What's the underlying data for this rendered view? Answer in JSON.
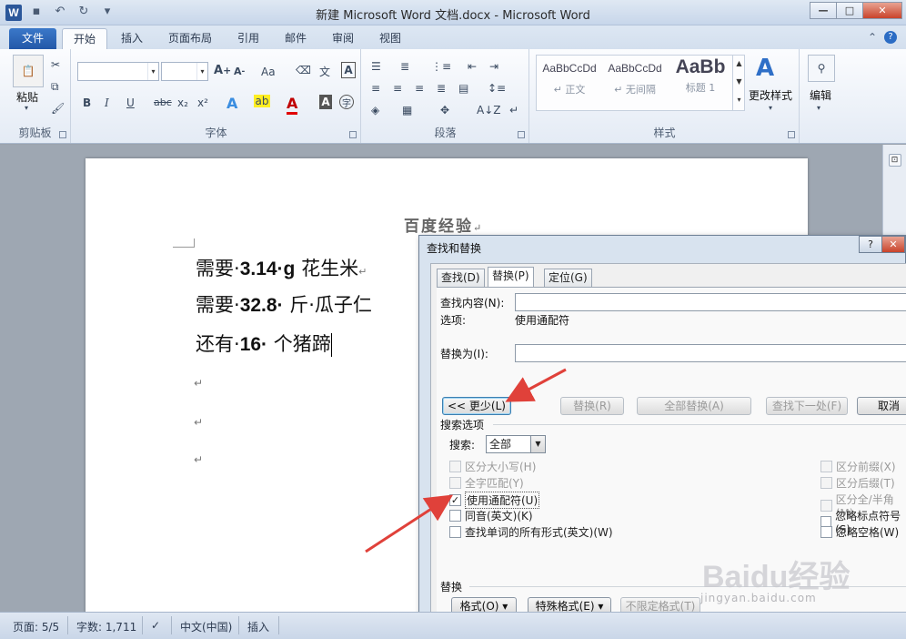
{
  "window": {
    "title": "新建 Microsoft Word 文档.docx - Microsoft Word"
  },
  "tabs": [
    "文件",
    "开始",
    "插入",
    "页面布局",
    "引用",
    "邮件",
    "审阅",
    "视图"
  ],
  "ribbon": {
    "clipboard": {
      "paste_label": "粘贴",
      "group_label": "剪贴板"
    },
    "font": {
      "group_label": "字体",
      "case_label": "Aa"
    },
    "paragraph": {
      "group_label": "段落"
    },
    "styles": {
      "group_label": "样式",
      "items": [
        {
          "preview": "AaBbCcDd",
          "name": "↵ 正文"
        },
        {
          "preview": "AaBbCcDd",
          "name": "↵ 无间隔"
        },
        {
          "preview": "AaBb",
          "name": "标题 1"
        }
      ],
      "change_styles_label": "更改样式"
    },
    "editing": {
      "label": "编辑"
    }
  },
  "document": {
    "header": "百度经验",
    "lines": [
      {
        "a": "需要·",
        "b": "3.14·g",
        "c": "花生米"
      },
      {
        "a": "需要·",
        "b": "32.8·",
        "c": "斤·瓜子仁"
      },
      {
        "a": "还有·",
        "b": "16·",
        "c": "个猪蹄"
      }
    ],
    "para_mark": "↵"
  },
  "dialog": {
    "title": "查找和替换",
    "tabs": [
      "查找(D)",
      "替换(P)",
      "定位(G)"
    ],
    "find_label": "查找内容(N):",
    "options_label": "选项:",
    "options_value": "使用通配符",
    "replace_label": "替换为(I):",
    "less_button": "<< 更少(L)",
    "replace_button": "替换(R)",
    "replace_all_button": "全部替换(A)",
    "find_next_button": "查找下一处(F)",
    "cancel_button": "取消",
    "search_options_title": "搜索选项",
    "search_label": "搜索:",
    "search_value": "全部",
    "left_options": [
      {
        "label": "区分大小写(H)",
        "checked": false,
        "disabled": true
      },
      {
        "label": "全字匹配(Y)",
        "checked": false,
        "disabled": true
      },
      {
        "label": "使用通配符(U)",
        "checked": true,
        "disabled": false
      },
      {
        "label": "同音(英文)(K)",
        "checked": false,
        "disabled": false
      },
      {
        "label": "查找单词的所有形式(英文)(W)",
        "checked": false,
        "disabled": false
      }
    ],
    "right_options": [
      {
        "label": "区分前缀(X)",
        "checked": false,
        "disabled": true
      },
      {
        "label": "区分后缀(T)",
        "checked": false,
        "disabled": true
      },
      {
        "label": "区分全/半角(M)",
        "checked": false,
        "disabled": true
      },
      {
        "label": "忽略标点符号(S)",
        "checked": false,
        "disabled": false
      },
      {
        "label": "忽略空格(W)",
        "checked": false,
        "disabled": false
      }
    ],
    "replace_section_title": "替换",
    "format_button": "格式(O) ▾",
    "special_button": "特殊格式(E) ▾",
    "no_format_button": "不限定格式(T)"
  },
  "statusbar": {
    "page": "页面: 5/5",
    "words": "字数: 1,711",
    "language": "中文(中国)",
    "mode": "插入"
  },
  "watermark": {
    "brand": "Baidu经验",
    "url": "jingyan.baidu.com"
  },
  "colors": {
    "arrow": "#e0413a",
    "file_tab": "#2b5fae"
  }
}
